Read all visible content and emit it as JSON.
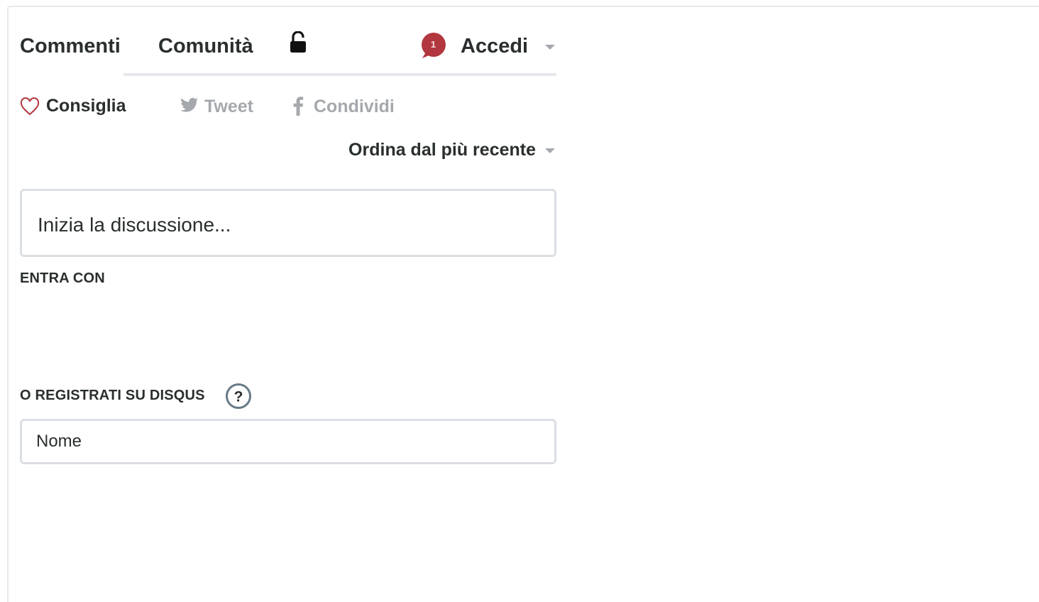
{
  "nav": {
    "tabs": [
      {
        "label": "Commenti",
        "active": true
      },
      {
        "label": "Comunità",
        "active": false
      }
    ],
    "lock_icon": "unlocked-padlock-icon",
    "notification_count": "1",
    "login_label": "Accedi"
  },
  "actions": {
    "recommend_label": "Consiglia",
    "tweet_label": "Tweet",
    "share_label": "Condividi"
  },
  "sort": {
    "label": "Ordina dal più recente"
  },
  "compose": {
    "placeholder": "Inizia la discussione..."
  },
  "login_section": {
    "enter_with_label": "ENTRA CON",
    "register_label": "O REGISTRATI SU DISQUS",
    "help_icon": "question-mark-icon",
    "name_placeholder": "Nome"
  },
  "colors": {
    "text": "#2a2e2e",
    "muted": "#a5a9ad",
    "border": "#dbdfe4",
    "notification": "#b2373f",
    "heart": "#b2373f"
  }
}
